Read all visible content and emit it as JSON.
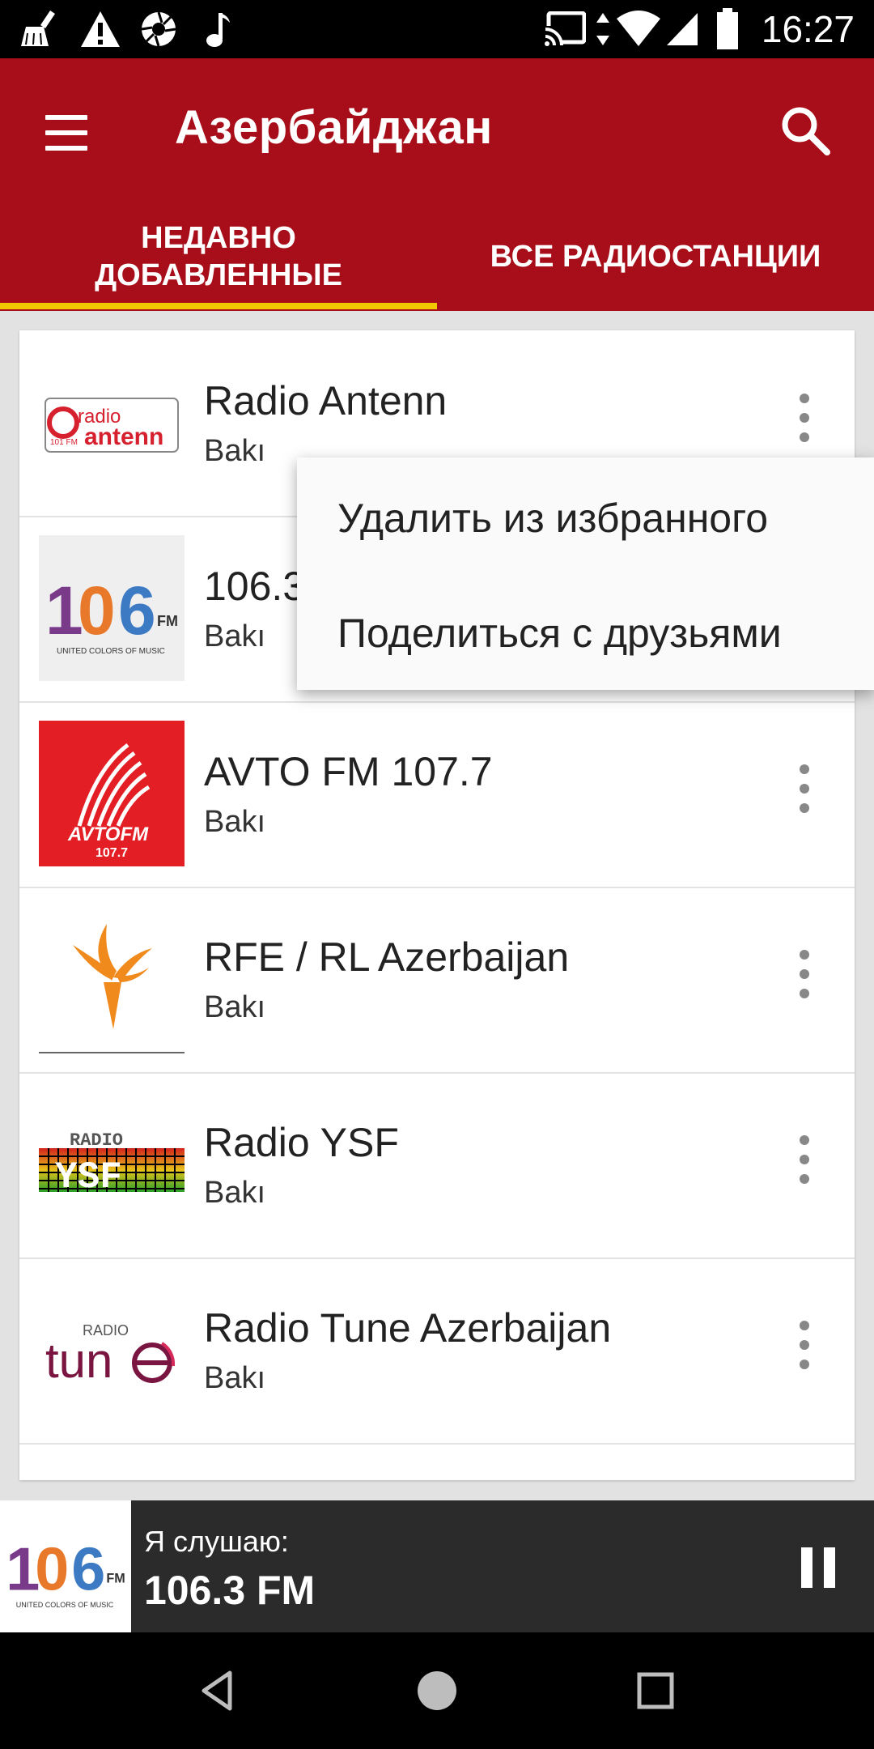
{
  "status_bar": {
    "time": "16:27",
    "icons_left": [
      "cleaner-icon",
      "warning-icon",
      "aperture-icon",
      "music-note-icon"
    ],
    "icons_right": [
      "cast-icon",
      "data-arrows-icon",
      "wifi-icon",
      "signal-icon",
      "battery-icon"
    ]
  },
  "app_bar": {
    "title": "Азербайджан",
    "menu_icon": "hamburger-menu-icon",
    "search_icon": "search-icon",
    "color": "#a80e19"
  },
  "tabs": [
    {
      "label": "НЕДАВНО ДОБАВЛЕННЫЕ",
      "selected": true
    },
    {
      "label": "ВСЕ РАДИОСТАНЦИИ",
      "selected": false
    }
  ],
  "tab_indicator_color": "#f2c800",
  "stations": [
    {
      "name": "Radio Antenn",
      "city": "Bakı",
      "logo": "radio-antenn-logo",
      "logo_text": "radio antenn 101 FM"
    },
    {
      "name": "106.3 FM",
      "city": "Bakı",
      "logo": "106-fm-logo",
      "logo_text": "106 FM UNITED COLORS OF MUSIC"
    },
    {
      "name": "AVTO FM 107.7",
      "city": "Bakı",
      "logo": "avto-fm-logo",
      "logo_text": "AVTOFM 107.7"
    },
    {
      "name": "RFE / RL Azerbaijan",
      "city": "Bakı",
      "logo": "rfe-rl-torch-logo",
      "logo_text": ""
    },
    {
      "name": "Radio YSF",
      "city": "Bakı",
      "logo": "radio-ysf-logo",
      "logo_text": "RADIO YSF"
    },
    {
      "name": "Radio Tune Azerbaijan",
      "city": "Bakı",
      "logo": "radio-tune-logo",
      "logo_text": "RADIO tune"
    }
  ],
  "popup_menu": {
    "items": [
      "Удалить из избранного",
      "Поделиться с друзьями"
    ]
  },
  "player": {
    "label": "Я слушаю:",
    "station": "106.3 FM",
    "state": "playing",
    "control_icon": "pause-icon"
  },
  "nav_bar": {
    "buttons": [
      "back-icon",
      "home-icon",
      "recents-icon"
    ]
  }
}
